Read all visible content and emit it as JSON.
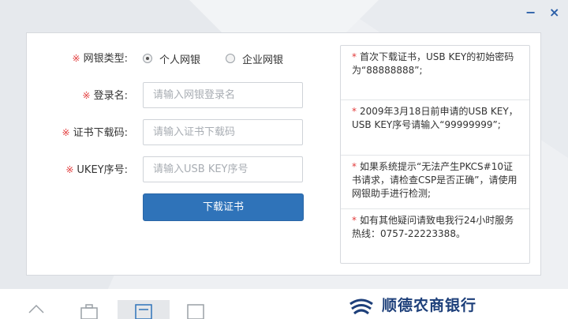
{
  "window": {
    "minimize_glyph": "−",
    "close_glyph": "×"
  },
  "form": {
    "required_mark": "※",
    "bank_type": {
      "label": "网银类型:",
      "options": [
        {
          "label": "个人网银",
          "checked": true
        },
        {
          "label": "企业网银",
          "checked": false
        }
      ]
    },
    "login_name": {
      "label": "登录名:",
      "placeholder": "请输入网银登录名",
      "value": ""
    },
    "download_code": {
      "label": "证书下载码:",
      "placeholder": "请输入证书下载码",
      "value": ""
    },
    "ukey_serial": {
      "label": "UKEY序号:",
      "placeholder": "请输入USB KEY序号",
      "value": ""
    },
    "submit_label": "下载证书"
  },
  "notes": {
    "star": "*",
    "items": [
      "首次下载证书，USB KEY的初始密码为“88888888”;",
      "2009年3月18日前申请的USB KEY，USB KEY序号请输入“99999999”;",
      "如果系统提示“无法产生PKCS#10证书请求，请检查CSP是否正确”，请使用网银助手进行检测;",
      "如有其他疑问请致电我行24小时服务热线：0757-22223388。"
    ]
  },
  "footer": {
    "bank_name": "顺德农商银行"
  },
  "colors": {
    "accent": "#2f73b9",
    "required": "#e23b3b",
    "brand": "#1d3f7a"
  },
  "icons": [
    "minimize-icon",
    "close-icon",
    "home-tab-icon",
    "briefcase-tab-icon",
    "certificate-tab-icon",
    "device-tab-icon",
    "bank-logo-icon"
  ]
}
